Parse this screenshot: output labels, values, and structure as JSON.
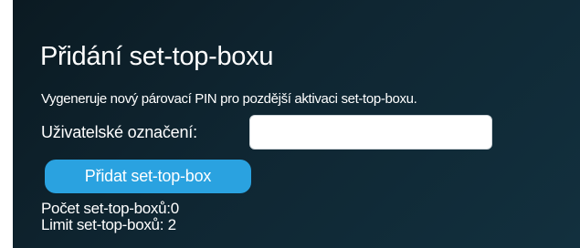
{
  "section": {
    "title": "Přidání set-top-boxu",
    "description": "Vygeneruje nový párovací PIN pro pozdější aktivaci set-top-boxu."
  },
  "form": {
    "label": "Uživatelské označení:",
    "value": "",
    "button_label": "Přidat set-top-box"
  },
  "stats": {
    "count_label": "Počet set-top-boxů:",
    "count_value": "0",
    "limit_label": "Limit set-top-boxů:",
    "limit_value": "2"
  },
  "colors": {
    "background": "#0f2632",
    "button": "#2aa2e0",
    "text": "#ffffff"
  }
}
